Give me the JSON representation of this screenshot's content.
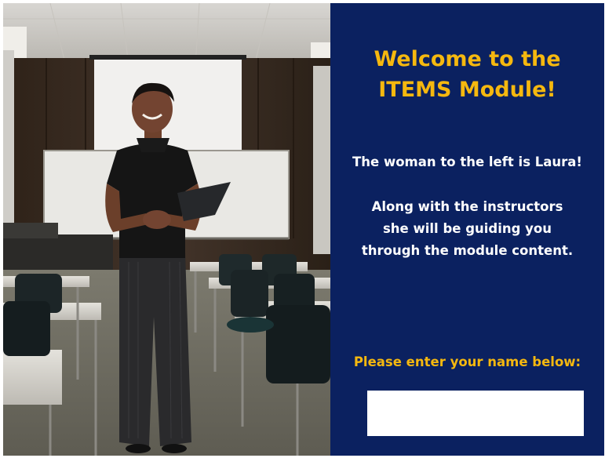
{
  "photo": {
    "description_icon": "woman-with-tablet-in-classroom-image"
  },
  "panel": {
    "title_line1": "Welcome to the",
    "title_line2": "ITEMS Module!",
    "intro": "The woman to the left is Laura!",
    "guide_line1": "Along with the instructors",
    "guide_line2": "she will be guiding you",
    "guide_line3": "through the module content.",
    "prompt": "Please enter your name below:",
    "name_value": "",
    "name_placeholder": ""
  },
  "colors": {
    "panel_bg": "#0b2160",
    "accent": "#f5b80f",
    "text": "#ffffff"
  }
}
